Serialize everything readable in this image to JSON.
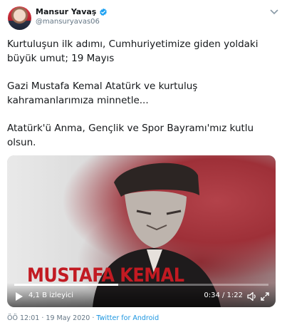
{
  "author": {
    "name": "Mansur Yavaş",
    "handle": "@mansuryavas06"
  },
  "tweet": {
    "paragraphs": [
      "Kurtuluşun ilk adımı, Cumhuriyetimize giden yoldaki büyük umut; 19 Mayıs",
      "Gazi Mustafa Kemal Atatürk ve kurtuluş kahramanlarımıza minnetle...",
      "Atatürk'ü Anma, Gençlik ve Spor Bayramı'mız kutlu olsun."
    ]
  },
  "video": {
    "caption": "MUSTAFA KEMAL",
    "views": "4,1 B izleyici",
    "time": "0:34 / 1:22",
    "progress": 0.41
  },
  "meta": {
    "timestamp": "ÖÖ 12:01 · 19 May 2020 · ",
    "app": "Twitter for Android"
  },
  "colors": {
    "verified": "#1da1f2",
    "caption": "#c21a22",
    "link": "#1b95e0"
  },
  "icons": [
    "verified-badge-icon",
    "chevron-down-icon",
    "play-icon",
    "volume-icon",
    "fullscreen-icon"
  ]
}
